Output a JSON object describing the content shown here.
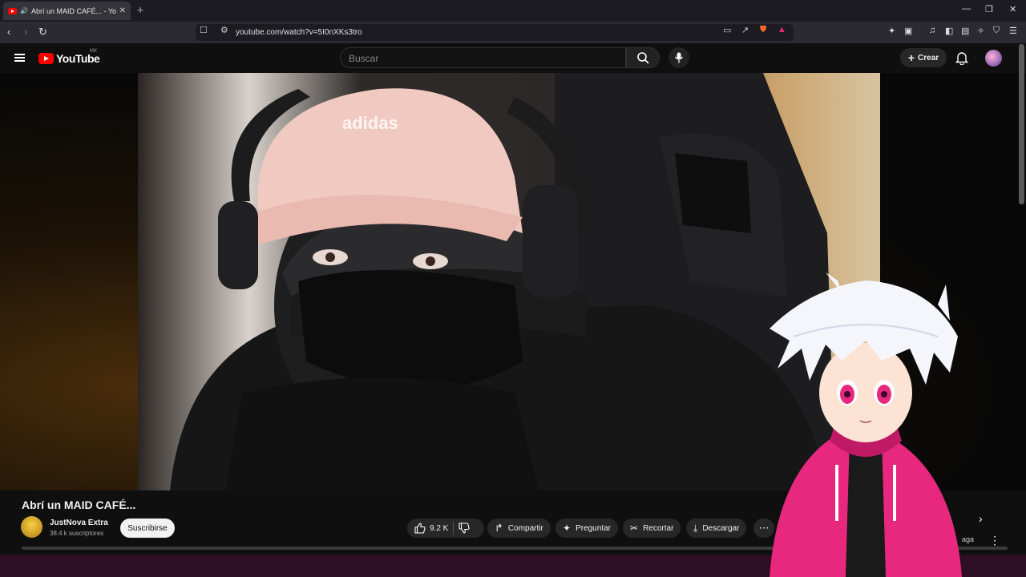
{
  "browser": {
    "tab_title": "Abrí un MAID CAFÉ... - YouTube",
    "url": "youtube.com/watch?v=5I0nXKs3tro"
  },
  "youtube": {
    "logo": "YouTube",
    "region": "MX",
    "search_placeholder": "Buscar",
    "create_label": "Crear"
  },
  "video": {
    "title": "Abrí un MAID CAFÉ...",
    "channel": "JustNova Extra",
    "subscribers": "38.4 k suscriptores",
    "subscribe_label": "Suscribirse",
    "likes": "9.2 K",
    "actions": {
      "share": "Compartir",
      "ask": "Preguntar",
      "clip": "Recortar",
      "download": "Descargar"
    },
    "side_label": "aga"
  },
  "colors": {
    "brand": "#ff0000",
    "background": "#0f0f0f",
    "accent_hoodie": "#e8287f"
  }
}
